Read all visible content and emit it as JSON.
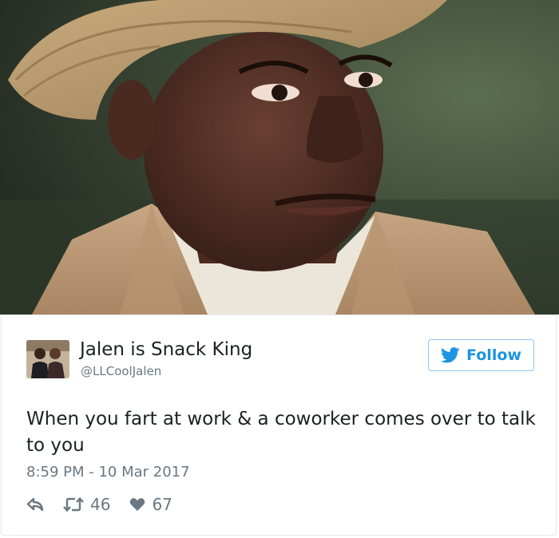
{
  "media": {
    "description_icon": "photo-icon"
  },
  "author": {
    "display_name": "Jalen is Snack King",
    "handle": "@LLCoolJalen",
    "avatar_icon": "avatar-photo"
  },
  "follow_button": {
    "label": "Follow",
    "icon": "twitter-bird-icon",
    "color": "#1b95e0"
  },
  "tweet": {
    "text": "When you fart at work & a coworker comes over to talk to you",
    "timestamp": "8:59 PM - 10 Mar 2017"
  },
  "actions": {
    "reply_icon": "reply-icon",
    "retweet_icon": "retweet-icon",
    "retweet_count": "46",
    "like_icon": "heart-icon",
    "like_count": "67"
  }
}
